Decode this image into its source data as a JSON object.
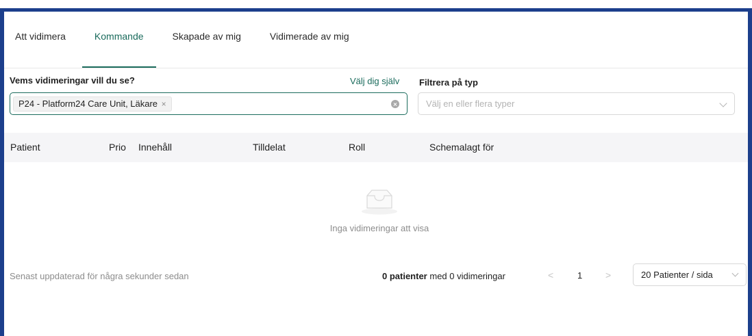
{
  "tabs": [
    {
      "label": "Att vidimera",
      "active": false
    },
    {
      "label": "Kommande",
      "active": true
    },
    {
      "label": "Skapade av mig",
      "active": false
    },
    {
      "label": "Vidimerade av mig",
      "active": false
    }
  ],
  "filters": {
    "whose_label": "Vems vidimeringar vill du se?",
    "select_self_link": "Välj dig själv",
    "selected_tag": "P24 - Platform24 Care Unit, Läkare",
    "tag_remove_glyph": "×",
    "type_label": "Filtrera på typ",
    "type_placeholder": "Välj en eller flera typer"
  },
  "table": {
    "columns": [
      "Patient",
      "Prio",
      "Innehåll",
      "Tilldelat",
      "Roll",
      "Schemalagt för"
    ],
    "rows": [],
    "empty_text": "Inga vidimeringar att visa"
  },
  "footer": {
    "updated_text": "Senast uppdaterad för några sekunder sedan",
    "patients_count": "0 patienter",
    "with_text": "med 0 vidimeringar",
    "prev_glyph": "<",
    "current_page": "1",
    "next_glyph": ">",
    "page_size": "20 Patienter / sida"
  },
  "colors": {
    "accent": "#1a6b5c",
    "frame": "#1c3f8c",
    "table_header_bg": "#f5f5f7",
    "muted_text": "#8c8c8c"
  },
  "icons": [
    "tag-close-icon",
    "clear-icon",
    "chevron-down-icon",
    "empty-inbox-icon"
  ]
}
